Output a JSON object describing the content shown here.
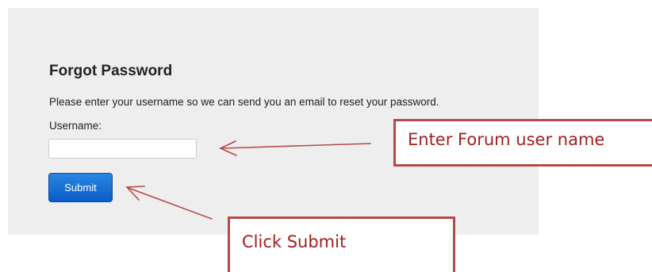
{
  "form": {
    "title": "Forgot Password",
    "instructions": "Please enter your username so we can send you an email to reset your password.",
    "username_label": "Username:",
    "username_value": "",
    "submit_label": "Submit"
  },
  "annotations": {
    "username_callout": "Enter Forum user name",
    "submit_callout": "Click Submit"
  },
  "colors": {
    "panel_background": "#eeeeee",
    "button_primary": "#0b5cc7",
    "annotation_border": "#b44a4a",
    "annotation_text": "#a02020"
  }
}
